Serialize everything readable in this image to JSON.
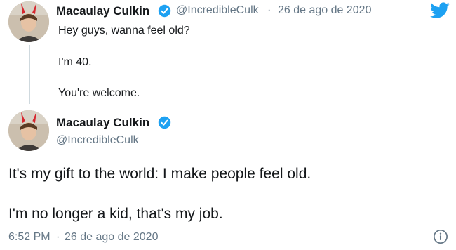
{
  "reply_tweet": {
    "author_name": "Macaulay Culkin",
    "handle": "@IncredibleCulk",
    "separator": "·",
    "date": "26 de ago de 2020",
    "lines": [
      "Hey guys, wanna feel old?",
      "I'm 40.",
      "You're welcome."
    ]
  },
  "main_tweet": {
    "author_name": "Macaulay Culkin",
    "handle": "@IncredibleCulk",
    "lines": [
      "It's my gift to the world: I make people feel old.",
      "I'm no longer a kid, that's my job."
    ],
    "time": "6:52 PM",
    "separator": "·",
    "date": "26 de ago de 2020"
  },
  "icons": {
    "brand": "twitter-bird-icon",
    "verified": "verified-badge-icon",
    "info": "info-icon"
  },
  "colors": {
    "twitter_blue": "#1da1f2",
    "muted_text": "#657786",
    "thread_line": "#cfd9de"
  }
}
